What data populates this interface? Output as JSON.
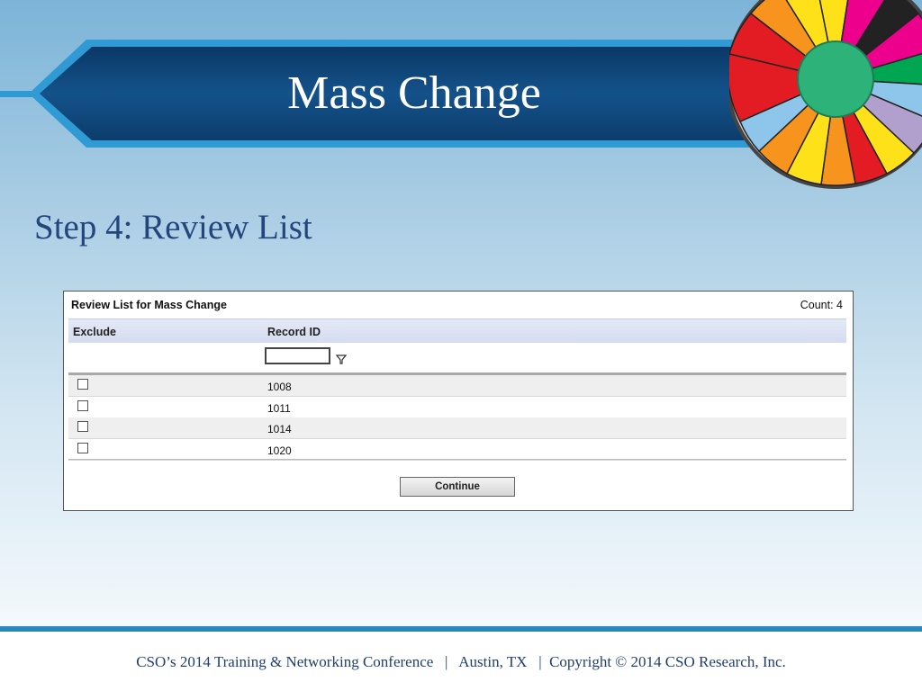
{
  "slide": {
    "title": "Mass Change",
    "subtitle": "Step 4: Review List",
    "footer": "CSO’s 2014 Training & Networking Conference   |   Austin, TX   |  Copyright © 2014 CSO Research, Inc."
  },
  "panel": {
    "title": "Review List for Mass Change",
    "count": "Count: 4",
    "columns": {
      "exclude": "Exclude",
      "record_id": "Record ID"
    },
    "filter_value": "",
    "rows": [
      {
        "record_id": "1008",
        "excluded": false
      },
      {
        "record_id": "1011",
        "excluded": false
      },
      {
        "record_id": "1014",
        "excluded": false
      },
      {
        "record_id": "1020",
        "excluded": false
      }
    ],
    "continue_label": "Continue"
  },
  "colors": {
    "banner_dark": "#0d3c68",
    "banner_outline": "#2f9ad3",
    "subtitle": "#23467d",
    "footer_text": "#1f3f73",
    "footer_band": "#2a87bd"
  },
  "icons": [
    "filter-icon",
    "wheel-of-fortune-graphic"
  ]
}
